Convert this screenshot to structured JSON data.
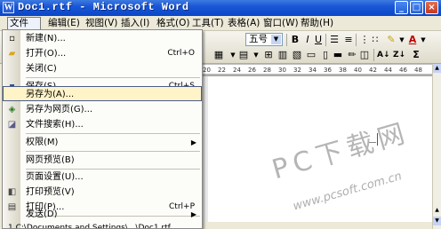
{
  "window": {
    "title": "Doc1.rtf - Microsoft Word",
    "app_icon_letter": "W",
    "buttons": {
      "minimize": "_",
      "maximize": "□",
      "close": "×"
    }
  },
  "menubar": {
    "items": [
      {
        "label": "文件(F)"
      },
      {
        "label": "编辑(E)"
      },
      {
        "label": "视图(V)"
      },
      {
        "label": "插入(I)"
      },
      {
        "label": "格式(O)"
      },
      {
        "label": "工具(T)"
      },
      {
        "label": "表格(A)"
      },
      {
        "label": "窗口(W)"
      },
      {
        "label": "帮助(H)"
      }
    ]
  },
  "toolbar": {
    "font_size": "五号",
    "bold": "B",
    "italic": "I",
    "underline": "U",
    "font_color_label": "A",
    "sort_label": "A↓",
    "sum_label": "Σ"
  },
  "ruler": {
    "ticks": [
      "20",
      "22",
      "24",
      "26",
      "28",
      "30",
      "32",
      "34",
      "36",
      "38",
      "40",
      "42",
      "44",
      "46",
      "48"
    ]
  },
  "file_menu": {
    "items": [
      {
        "icon": "new-doc-icon",
        "glyph": "▫",
        "label": "新建(N)...",
        "shortcut": ""
      },
      {
        "icon": "open-folder-icon",
        "glyph": "▰",
        "label": "打开(O)...",
        "shortcut": "Ctrl+O"
      },
      {
        "icon": "",
        "glyph": "",
        "label": "关闭(C)",
        "shortcut": ""
      },
      {
        "icon": "save-icon",
        "glyph": "▪",
        "label": "保存(S)",
        "shortcut": "Ctrl+S"
      },
      {
        "icon": "",
        "glyph": "",
        "label": "另存为(A)...",
        "shortcut": ""
      },
      {
        "icon": "web-page-icon",
        "glyph": "◈",
        "label": "另存为网页(G)...",
        "shortcut": ""
      },
      {
        "icon": "file-search-icon",
        "glyph": "◪",
        "label": "文件搜索(H)...",
        "shortcut": ""
      },
      {
        "icon": "",
        "glyph": "",
        "label": "权限(M)",
        "shortcut": ""
      },
      {
        "icon": "",
        "glyph": "",
        "label": "网页预览(B)",
        "shortcut": ""
      },
      {
        "icon": "",
        "glyph": "",
        "label": "页面设置(U)...",
        "shortcut": ""
      },
      {
        "icon": "print-preview-icon",
        "glyph": "◧",
        "label": "打印预览(V)",
        "shortcut": ""
      },
      {
        "icon": "print-icon",
        "glyph": "▤",
        "label": "打印(P)...",
        "shortcut": "Ctrl+P"
      },
      {
        "icon": "",
        "glyph": "",
        "label": "发送(D)",
        "shortcut": ""
      },
      {
        "icon": "",
        "glyph": "",
        "label": "1 C:\\Documents and Settings\\...\\Doc1.rtf",
        "shortcut": ""
      }
    ],
    "highlighted_index": 4
  },
  "watermark": {
    "text": "PC下载网",
    "url": "www.pcsoft.com.cn"
  },
  "colors": {
    "titlebar": "#0a46c8",
    "menu_bg": "#ece9d8",
    "highlight_bg": "#fff3c8",
    "highlight_border": "#4a5d8a"
  }
}
